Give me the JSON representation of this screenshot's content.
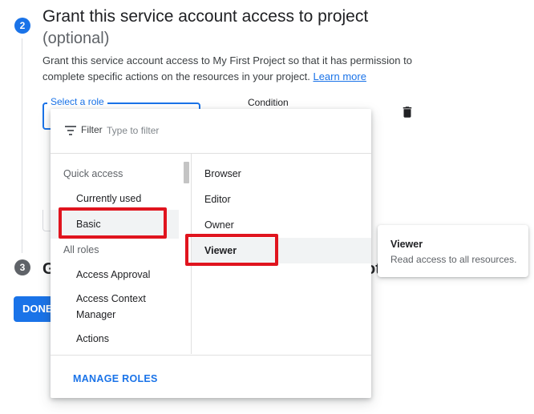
{
  "step2": {
    "number": "2",
    "title": "Grant this service account access to project",
    "optional": "(optional)",
    "description": "Grant this service account access to My First Project so that it has permission to complete specific actions on the resources in your project.",
    "learn_more": "Learn more"
  },
  "role_field": {
    "label": "Select a role"
  },
  "condition": {
    "label": "Condition"
  },
  "step3": {
    "number": "3",
    "title_start": "G",
    "title_end": "ot"
  },
  "done_button": "DONE",
  "menu": {
    "filter_label": "Filter",
    "filter_placeholder": "Type to filter",
    "quick_access_heading": "Quick access",
    "quick_access_items": [
      "Currently used",
      "Basic"
    ],
    "all_roles_heading": "All roles",
    "all_roles_items": [
      "Access Approval",
      "Access Context Manager",
      "Actions"
    ],
    "roles": [
      "Browser",
      "Editor",
      "Owner",
      "Viewer"
    ],
    "manage_roles": "MANAGE ROLES"
  },
  "tooltip": {
    "title": "Viewer",
    "description": "Read access to all resources."
  },
  "colors": {
    "accent": "#1a73e8",
    "annotation_red": "#e0141e"
  },
  "icons": {
    "filter": "filter-icon",
    "delete": "trash-icon"
  }
}
